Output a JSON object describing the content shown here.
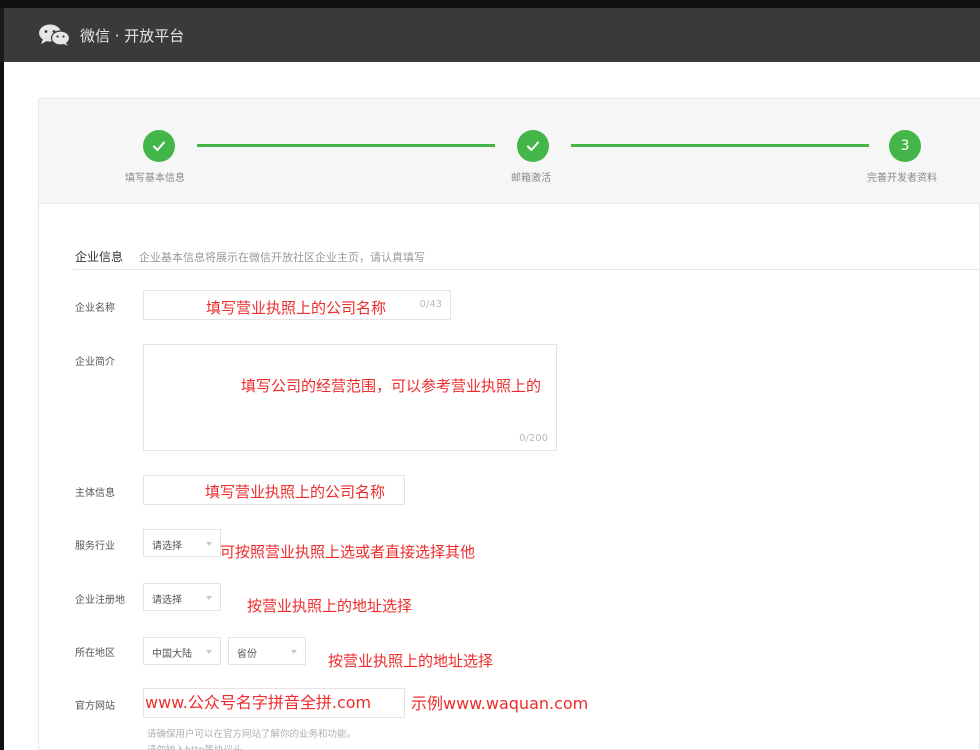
{
  "header": {
    "brand": "微信 · 开放平台",
    "logo_icon": "wechat-logo-icon",
    "background": "#3a3a3a"
  },
  "steps": [
    {
      "label": "填写基本信息",
      "status": "done",
      "icon": "check-icon"
    },
    {
      "label": "邮箱激活",
      "status": "done",
      "icon": "check-icon"
    },
    {
      "label": "完善开发者资料",
      "status": "current",
      "number": "3"
    }
  ],
  "section": {
    "title": "企业信息",
    "description": "企业基本信息将展示在微信开放社区企业主页，请认真填写"
  },
  "form": {
    "company_name": {
      "label": "企业名称",
      "counter": "0/43",
      "annotation": "填写营业执照上的公司名称"
    },
    "company_intro": {
      "label": "企业简介",
      "counter": "0/200",
      "annotation": "填写公司的经营范围，可以参考营业执照上的"
    },
    "entity_info": {
      "label": "主体信息",
      "annotation": "填写营业执照上的公司名称"
    },
    "industry": {
      "label": "服务行业",
      "selected": "请选择",
      "annotation": "可按照营业执照上选或者直接选择其他"
    },
    "registered_place": {
      "label": "企业注册地",
      "selected": "请选择",
      "annotation": "按营业执照上的地址选择"
    },
    "region": {
      "label": "所在地区",
      "country": "中国大陆",
      "province": "省份",
      "annotation": "按营业执照上的地址选择"
    },
    "website": {
      "label": "官方网站",
      "value": "www.公众号名字拼音全拼.com",
      "annotation": "示例www.waquan.com",
      "hint1": "请确保用户可以在官方网站了解你的业务和功能。",
      "hint2": "请勿输入http等协议头"
    }
  },
  "colors": {
    "accent": "#44b549",
    "annotation": "#ee2c2c"
  }
}
